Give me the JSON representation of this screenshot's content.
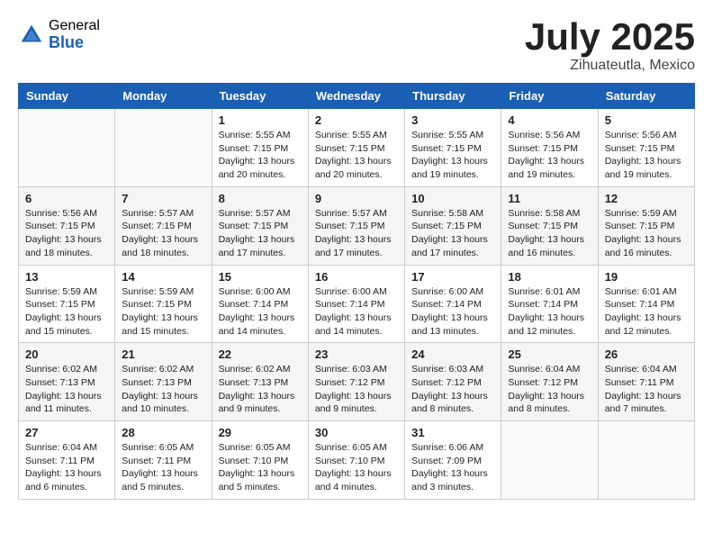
{
  "logo": {
    "general": "General",
    "blue": "Blue"
  },
  "title": "July 2025",
  "location": "Zihuateutla, Mexico",
  "days_of_week": [
    "Sunday",
    "Monday",
    "Tuesday",
    "Wednesday",
    "Thursday",
    "Friday",
    "Saturday"
  ],
  "weeks": [
    [
      {
        "day": "",
        "detail": ""
      },
      {
        "day": "",
        "detail": ""
      },
      {
        "day": "1",
        "detail": "Sunrise: 5:55 AM\nSunset: 7:15 PM\nDaylight: 13 hours\nand 20 minutes."
      },
      {
        "day": "2",
        "detail": "Sunrise: 5:55 AM\nSunset: 7:15 PM\nDaylight: 13 hours\nand 20 minutes."
      },
      {
        "day": "3",
        "detail": "Sunrise: 5:55 AM\nSunset: 7:15 PM\nDaylight: 13 hours\nand 19 minutes."
      },
      {
        "day": "4",
        "detail": "Sunrise: 5:56 AM\nSunset: 7:15 PM\nDaylight: 13 hours\nand 19 minutes."
      },
      {
        "day": "5",
        "detail": "Sunrise: 5:56 AM\nSunset: 7:15 PM\nDaylight: 13 hours\nand 19 minutes."
      }
    ],
    [
      {
        "day": "6",
        "detail": "Sunrise: 5:56 AM\nSunset: 7:15 PM\nDaylight: 13 hours\nand 18 minutes."
      },
      {
        "day": "7",
        "detail": "Sunrise: 5:57 AM\nSunset: 7:15 PM\nDaylight: 13 hours\nand 18 minutes."
      },
      {
        "day": "8",
        "detail": "Sunrise: 5:57 AM\nSunset: 7:15 PM\nDaylight: 13 hours\nand 17 minutes."
      },
      {
        "day": "9",
        "detail": "Sunrise: 5:57 AM\nSunset: 7:15 PM\nDaylight: 13 hours\nand 17 minutes."
      },
      {
        "day": "10",
        "detail": "Sunrise: 5:58 AM\nSunset: 7:15 PM\nDaylight: 13 hours\nand 17 minutes."
      },
      {
        "day": "11",
        "detail": "Sunrise: 5:58 AM\nSunset: 7:15 PM\nDaylight: 13 hours\nand 16 minutes."
      },
      {
        "day": "12",
        "detail": "Sunrise: 5:59 AM\nSunset: 7:15 PM\nDaylight: 13 hours\nand 16 minutes."
      }
    ],
    [
      {
        "day": "13",
        "detail": "Sunrise: 5:59 AM\nSunset: 7:15 PM\nDaylight: 13 hours\nand 15 minutes."
      },
      {
        "day": "14",
        "detail": "Sunrise: 5:59 AM\nSunset: 7:15 PM\nDaylight: 13 hours\nand 15 minutes."
      },
      {
        "day": "15",
        "detail": "Sunrise: 6:00 AM\nSunset: 7:14 PM\nDaylight: 13 hours\nand 14 minutes."
      },
      {
        "day": "16",
        "detail": "Sunrise: 6:00 AM\nSunset: 7:14 PM\nDaylight: 13 hours\nand 14 minutes."
      },
      {
        "day": "17",
        "detail": "Sunrise: 6:00 AM\nSunset: 7:14 PM\nDaylight: 13 hours\nand 13 minutes."
      },
      {
        "day": "18",
        "detail": "Sunrise: 6:01 AM\nSunset: 7:14 PM\nDaylight: 13 hours\nand 12 minutes."
      },
      {
        "day": "19",
        "detail": "Sunrise: 6:01 AM\nSunset: 7:14 PM\nDaylight: 13 hours\nand 12 minutes."
      }
    ],
    [
      {
        "day": "20",
        "detail": "Sunrise: 6:02 AM\nSunset: 7:13 PM\nDaylight: 13 hours\nand 11 minutes."
      },
      {
        "day": "21",
        "detail": "Sunrise: 6:02 AM\nSunset: 7:13 PM\nDaylight: 13 hours\nand 10 minutes."
      },
      {
        "day": "22",
        "detail": "Sunrise: 6:02 AM\nSunset: 7:13 PM\nDaylight: 13 hours\nand 9 minutes."
      },
      {
        "day": "23",
        "detail": "Sunrise: 6:03 AM\nSunset: 7:12 PM\nDaylight: 13 hours\nand 9 minutes."
      },
      {
        "day": "24",
        "detail": "Sunrise: 6:03 AM\nSunset: 7:12 PM\nDaylight: 13 hours\nand 8 minutes."
      },
      {
        "day": "25",
        "detail": "Sunrise: 6:04 AM\nSunset: 7:12 PM\nDaylight: 13 hours\nand 8 minutes."
      },
      {
        "day": "26",
        "detail": "Sunrise: 6:04 AM\nSunset: 7:11 PM\nDaylight: 13 hours\nand 7 minutes."
      }
    ],
    [
      {
        "day": "27",
        "detail": "Sunrise: 6:04 AM\nSunset: 7:11 PM\nDaylight: 13 hours\nand 6 minutes."
      },
      {
        "day": "28",
        "detail": "Sunrise: 6:05 AM\nSunset: 7:11 PM\nDaylight: 13 hours\nand 5 minutes."
      },
      {
        "day": "29",
        "detail": "Sunrise: 6:05 AM\nSunset: 7:10 PM\nDaylight: 13 hours\nand 5 minutes."
      },
      {
        "day": "30",
        "detail": "Sunrise: 6:05 AM\nSunset: 7:10 PM\nDaylight: 13 hours\nand 4 minutes."
      },
      {
        "day": "31",
        "detail": "Sunrise: 6:06 AM\nSunset: 7:09 PM\nDaylight: 13 hours\nand 3 minutes."
      },
      {
        "day": "",
        "detail": ""
      },
      {
        "day": "",
        "detail": ""
      }
    ]
  ]
}
